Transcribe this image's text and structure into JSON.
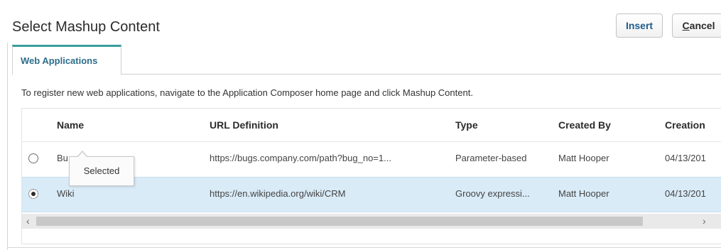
{
  "dialog": {
    "title": "Select Mashup Content",
    "insert_label": "Insert",
    "cancel_label_access_key": "C",
    "cancel_label_rest": "ancel"
  },
  "tabs": [
    {
      "label": "Web Applications",
      "selected": true
    }
  ],
  "instruction": "To register new web applications, navigate to the Application Composer home page and click Mashup Content.",
  "table": {
    "columns": [
      "Name",
      "URL Definition",
      "Type",
      "Created By",
      "Creation"
    ],
    "rows": [
      {
        "name": "Bu",
        "url": "https://bugs.company.com/path?bug_no=1...",
        "type": "Parameter-based",
        "created_by": "Matt Hooper",
        "creation": "04/13/201",
        "selected": false
      },
      {
        "name": "Wiki",
        "url": "https://en.wikipedia.org/wiki/CRM",
        "type": "Groovy expressi...",
        "created_by": "Matt Hooper",
        "creation": "04/13/201",
        "selected": true
      }
    ]
  },
  "tooltip": "Selected",
  "scrollbar": {
    "left_arrow": "‹",
    "right_arrow": "›"
  },
  "colors": {
    "accent_teal": "#3a9d9e",
    "selected_row": "#d9ebf7",
    "insert_text": "#1f5d8c"
  }
}
